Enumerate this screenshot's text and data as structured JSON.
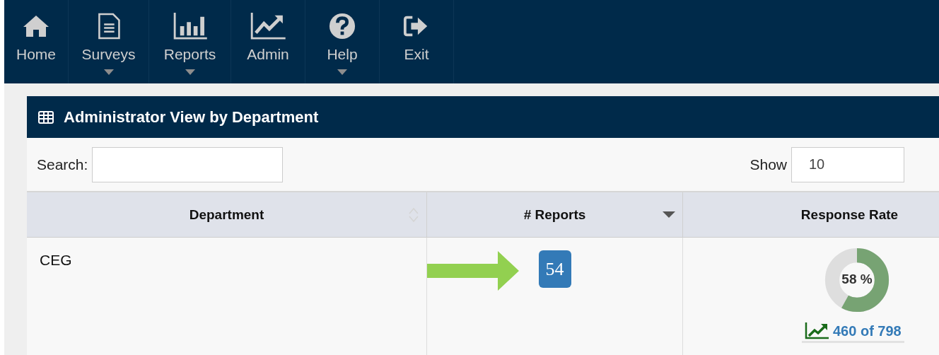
{
  "nav": [
    {
      "label": "Home",
      "has_menu": false
    },
    {
      "label": "Surveys",
      "has_menu": true
    },
    {
      "label": "Reports",
      "has_menu": true
    },
    {
      "label": "Admin",
      "has_menu": false
    },
    {
      "label": "Help",
      "has_menu": true
    },
    {
      "label": "Exit",
      "has_menu": false
    }
  ],
  "panel": {
    "title": "Administrator View by Department",
    "search": {
      "label": "Search:"
    },
    "show": {
      "label": "Show",
      "value": "10"
    },
    "table": {
      "columns": [
        {
          "label": "Department",
          "sortable": true,
          "sorted": false
        },
        {
          "label": "# Reports",
          "sortable": true,
          "sorted": true
        },
        {
          "label": "Response Rate",
          "sortable": false
        }
      ],
      "rows": [
        {
          "department": "CEG",
          "reports": "54",
          "highlighted": true,
          "rate": {
            "level": 0.58,
            "text": "58 %"
          },
          "responses": "460 of 798"
        }
      ]
    }
  }
}
